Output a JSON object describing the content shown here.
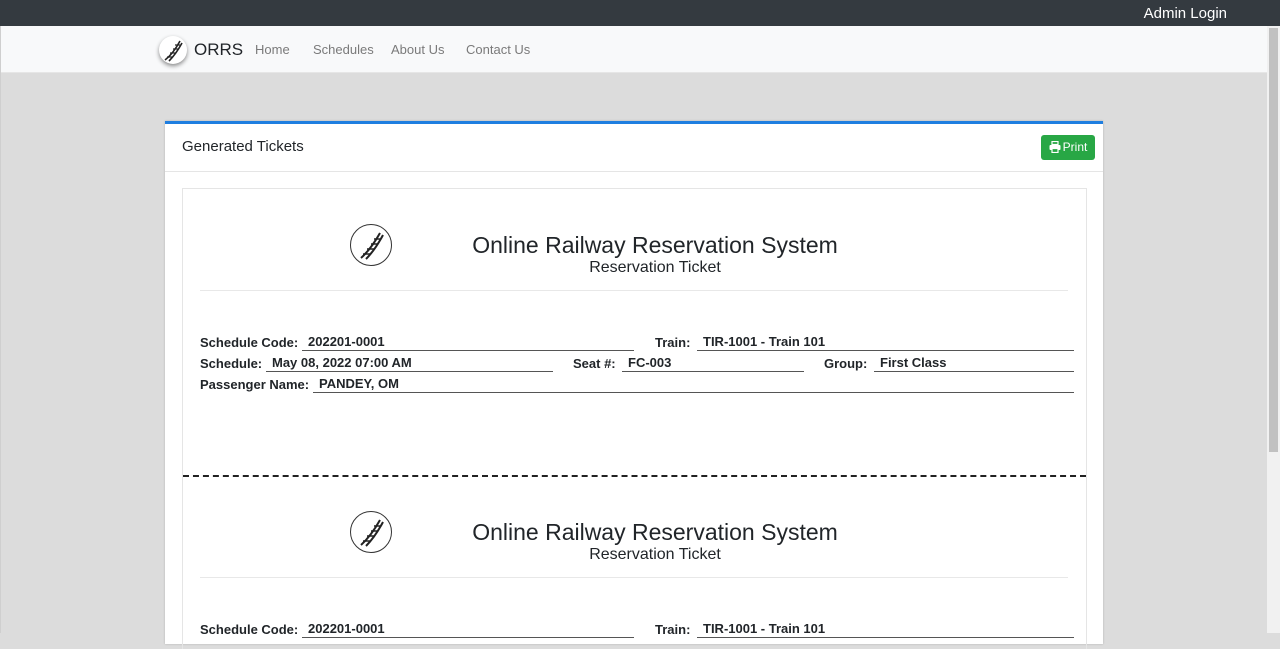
{
  "topbar": {
    "admin_login": "Admin Login"
  },
  "navbar": {
    "brand": "ORRS",
    "items": [
      "Home",
      "Schedules",
      "About Us",
      "Contact Us"
    ]
  },
  "card": {
    "title": "Generated Tickets",
    "print_label": "Print",
    "print_color": "#28a745",
    "accent_color": "#1e7ee0"
  },
  "tickets": [
    {
      "system_name": "Online Railway Reservation System",
      "subtitle": "Reservation Ticket",
      "labels": {
        "schedule_code": "Schedule Code:",
        "train": "Train:",
        "schedule": "Schedule:",
        "seat": "Seat #:",
        "group": "Group:",
        "passenger": "Passenger Name:"
      },
      "schedule_code": "202201-0001",
      "train": "TIR-1001 - Train 101",
      "schedule": "May 08, 2022 07:00 AM",
      "seat": "FC-003",
      "group": "First Class",
      "passenger": "PANDEY, OM"
    },
    {
      "system_name": "Online Railway Reservation System",
      "subtitle": "Reservation Ticket",
      "labels": {
        "schedule_code": "Schedule Code:",
        "train": "Train:"
      },
      "schedule_code": "202201-0001",
      "train": "TIR-1001 - Train 101"
    }
  ]
}
